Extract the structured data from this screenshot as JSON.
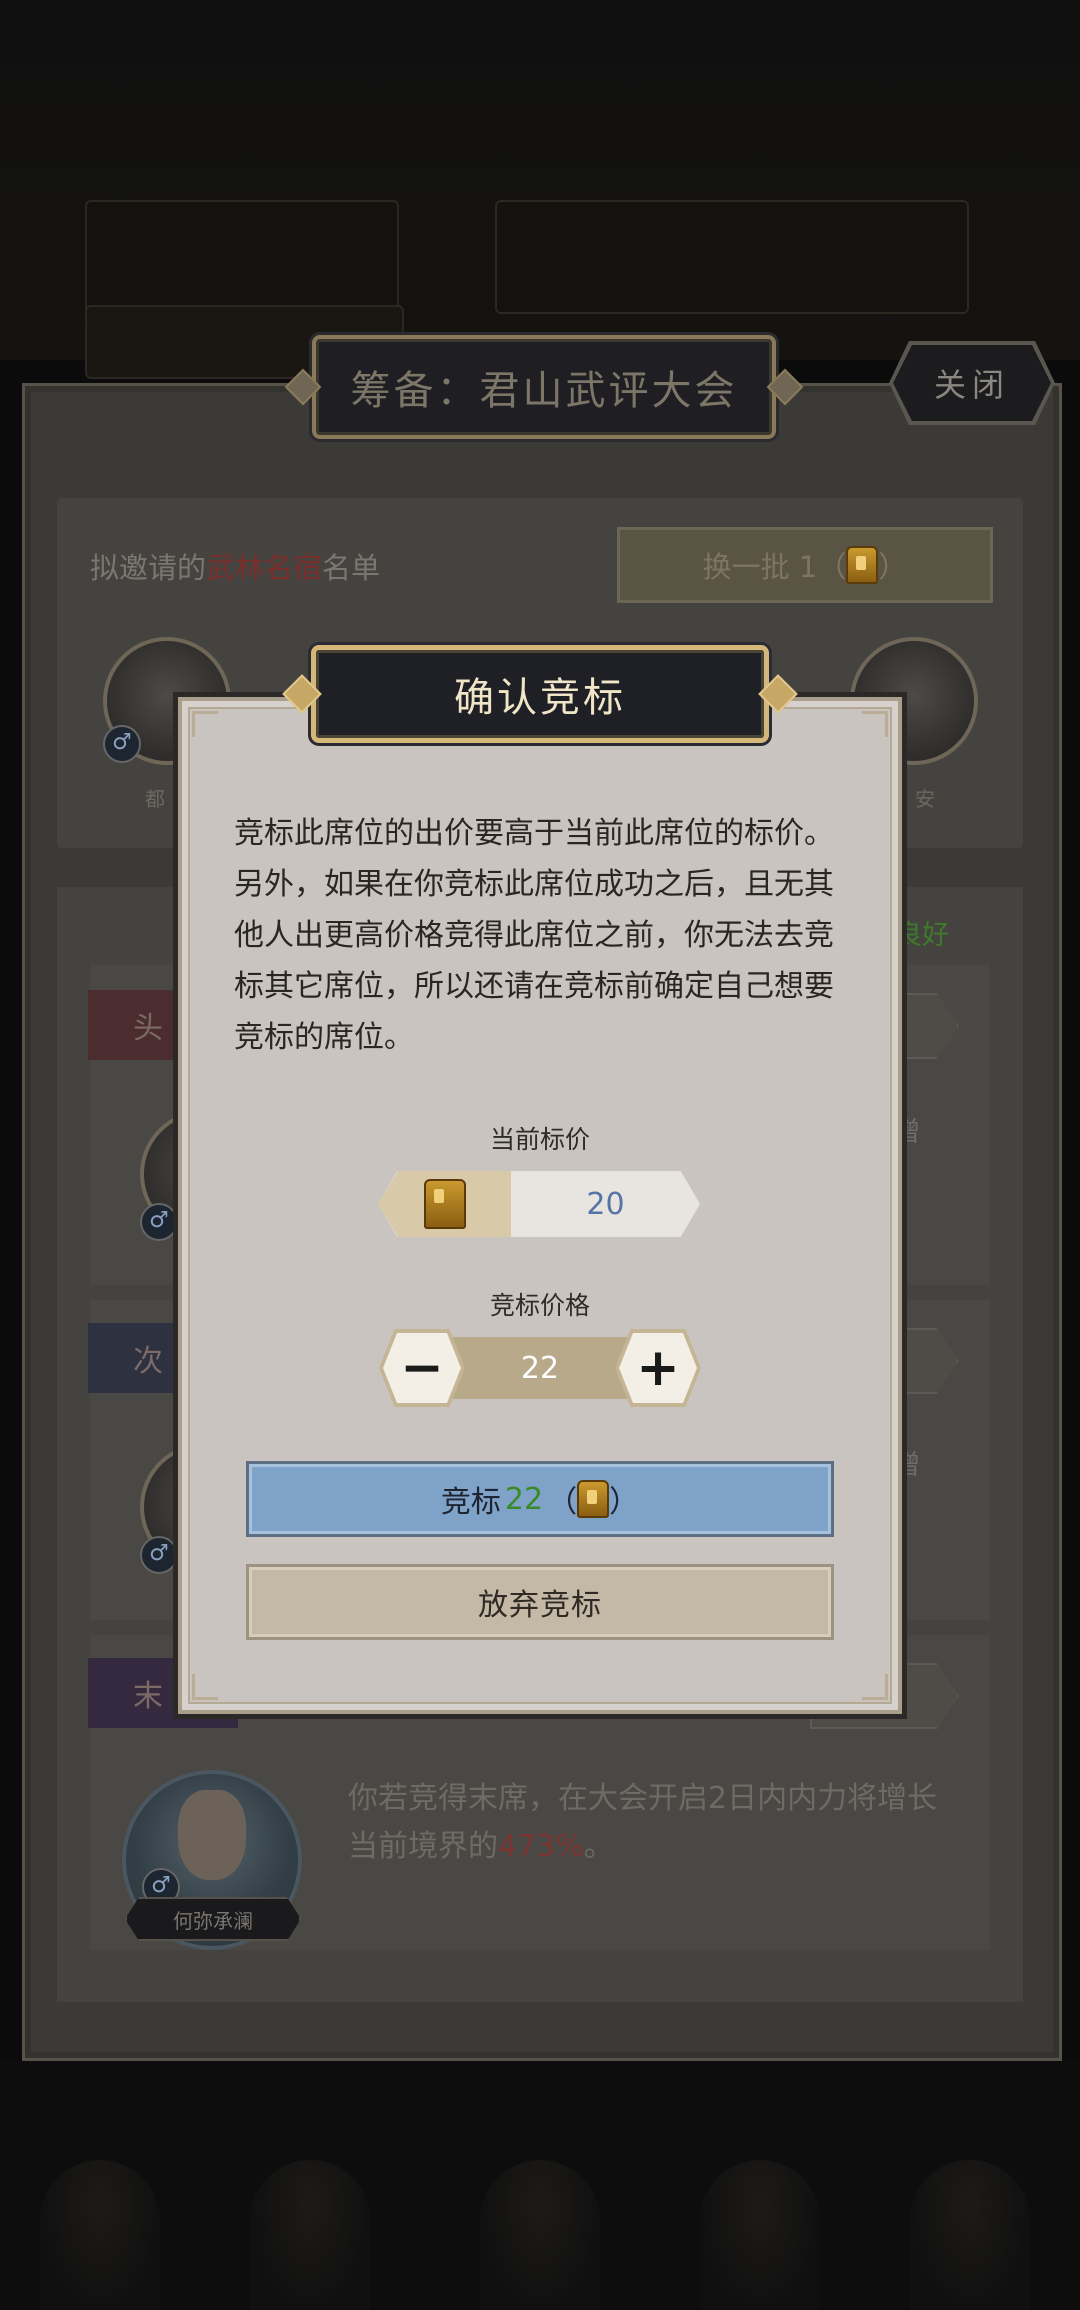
{
  "main": {
    "title": "筹备：君山武评大会",
    "close_label": "关闭",
    "invite": {
      "label_prefix": "拟邀请的",
      "label_highlight": "武林名宿",
      "label_suffix": "名单",
      "refresh_label": "换一批 1（",
      "refresh_label_end": "）",
      "heroes": [
        {
          "name": "都"
        },
        {
          "name": ""
        },
        {
          "name": ""
        },
        {
          "name": ""
        },
        {
          "name": "安"
        }
      ]
    },
    "status": {
      "value": "良好"
    },
    "seats": [
      {
        "tab": "头",
        "tail": "增"
      },
      {
        "tab": "次",
        "tail": "增"
      },
      {
        "tab": "末",
        "tail": ""
      }
    ],
    "last_seat": {
      "hero_name": "何弥承澜",
      "desc_before": "你若竞得末席，在大会开启2日内内力将增长当前境界的",
      "desc_pct": "473%",
      "desc_after": "。"
    }
  },
  "dialog": {
    "title": "确认竞标",
    "message": "竞标此席位的出价要高于当前此席位的标价。另外，如果在你竞标此席位成功之后，且无其他人出更高价格竞得此席位之前，你无法去竞标其它席位，所以还请在竞标前确定自己想要竞标的席位。",
    "current_bid_label": "当前标价",
    "current_bid_value": "20",
    "bid_price_label": "竞标价格",
    "minus_label": "−",
    "plus_label": "+",
    "bid_value": "22",
    "bid_button": {
      "prefix": "竞标",
      "amount": "22",
      "open": "（",
      "close": "）"
    },
    "abandon_label": "放弃竞标"
  },
  "icons": {
    "currency": "gold-token-icon",
    "gender": "male-icon"
  },
  "colors": {
    "bid_button": "#7fa2c8",
    "bid_amount": "#3b8a28",
    "current_bid_value": "#5574a8",
    "dialog_title_border": "#d6b77a"
  }
}
